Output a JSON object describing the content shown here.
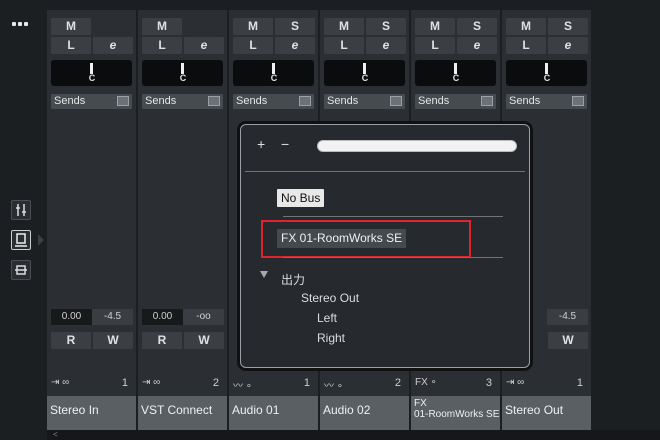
{
  "channels": [
    {
      "left": "M",
      "right": "",
      "pan": "C",
      "sends": "Sends",
      "volume": "0.00",
      "volume2": "-4.5",
      "routing_icon": "⇥ ∞",
      "routing_num": "1",
      "name": "Stereo In"
    },
    {
      "left": "M",
      "right": "",
      "pan": "C",
      "sends": "Sends",
      "volume": "0.00",
      "volume2": "-oo",
      "routing_icon": "⇥ ∞",
      "routing_num": "2",
      "name": "VST Connect"
    },
    {
      "left": "M",
      "right": "S",
      "pan": "C",
      "sends": "Sends",
      "routing_icon": "〰 ∘",
      "routing_num": "1",
      "name": "Audio 01"
    },
    {
      "left": "M",
      "right": "S",
      "pan": "C",
      "sends": "Sends",
      "routing_icon": "〰 ∘",
      "routing_num": "2",
      "name": "Audio 02"
    },
    {
      "left": "M",
      "right": "S",
      "pan": "C",
      "sends": "Sends",
      "routing_icon": "FX ∘",
      "routing_num": "3",
      "name_line1": "FX",
      "name_line2": "01-RoomWorks SE"
    },
    {
      "left": "M",
      "right": "S",
      "pan": "C",
      "sends": "Sends",
      "volume2": "-4.5",
      "routing_icon": "⇥ ∞",
      "routing_num": "1",
      "name": "Stereo Out"
    }
  ],
  "row2": {
    "l": "L",
    "e": "e"
  },
  "rw": {
    "r": "R",
    "w": "W"
  },
  "popup": {
    "plus": "+",
    "minus": "−",
    "no_bus": "No Bus",
    "fx_item": "FX 01-RoomWorks SE",
    "group_label": "出力",
    "stereo_out": "Stereo Out",
    "left": "Left",
    "right": "Right"
  },
  "bottom_scroll": "<"
}
